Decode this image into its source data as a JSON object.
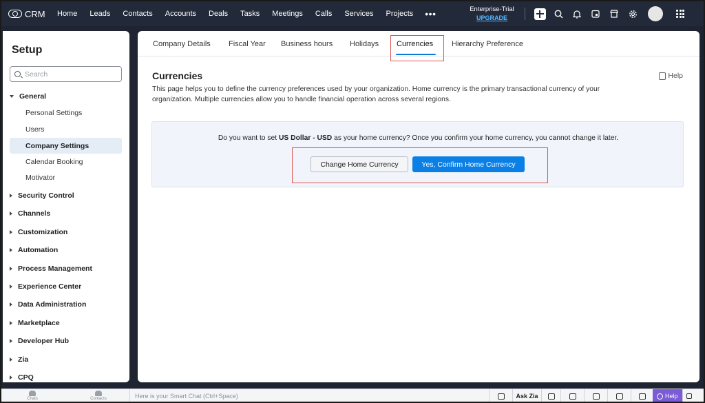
{
  "app": {
    "name": "CRM"
  },
  "topnav": {
    "items": [
      "Home",
      "Leads",
      "Contacts",
      "Accounts",
      "Deals",
      "Tasks",
      "Meetings",
      "Calls",
      "Services",
      "Projects"
    ],
    "more": "•••",
    "plan": "Enterprise-Trial",
    "upgrade": "UPGRADE",
    "icons": [
      "plus-icon",
      "search-icon",
      "bell-icon",
      "calendar-icon",
      "store-icon",
      "gear-icon",
      "avatar",
      "apps-grid-icon"
    ]
  },
  "sidebar": {
    "title": "Setup",
    "search_placeholder": "Search",
    "general": {
      "label": "General",
      "items": [
        "Personal Settings",
        "Users",
        "Company Settings",
        "Calendar Booking",
        "Motivator"
      ],
      "active": "Company Settings"
    },
    "groups": [
      "Security Control",
      "Channels",
      "Customization",
      "Automation",
      "Process Management",
      "Experience Center",
      "Data Administration",
      "Marketplace",
      "Developer Hub",
      "Zia",
      "CPQ"
    ]
  },
  "tabs": {
    "items": [
      "Company Details",
      "Fiscal Year",
      "Business hours",
      "Holidays",
      "Currencies",
      "Hierarchy Preference"
    ],
    "active": "Currencies"
  },
  "main": {
    "title": "Currencies",
    "help": "Help",
    "description": "This page helps you to define the currency preferences used by your organization. Home currency is the primary transactional currency of your organization. Multiple currencies allow you to handle financial operation across several regions.",
    "confirm": {
      "prefix": "Do you want to set ",
      "currency": "US Dollar - USD",
      "suffix": " as your home currency? Once you confirm your home currency, you cannot change it later.",
      "change_button": "Change Home Currency",
      "confirm_button": "Yes, Confirm Home Currency"
    }
  },
  "bottombar": {
    "chats": "Chats",
    "contacts": "Contacts",
    "smart_chat_placeholder": "Here is your Smart Chat (Ctrl+Space)",
    "ask_zia": "Ask Zia",
    "help": "Help"
  },
  "colors": {
    "topbar": "#222a3a",
    "accent": "#0a7fe6",
    "highlight": "#d9534f",
    "help_button": "#7b5bd6"
  }
}
